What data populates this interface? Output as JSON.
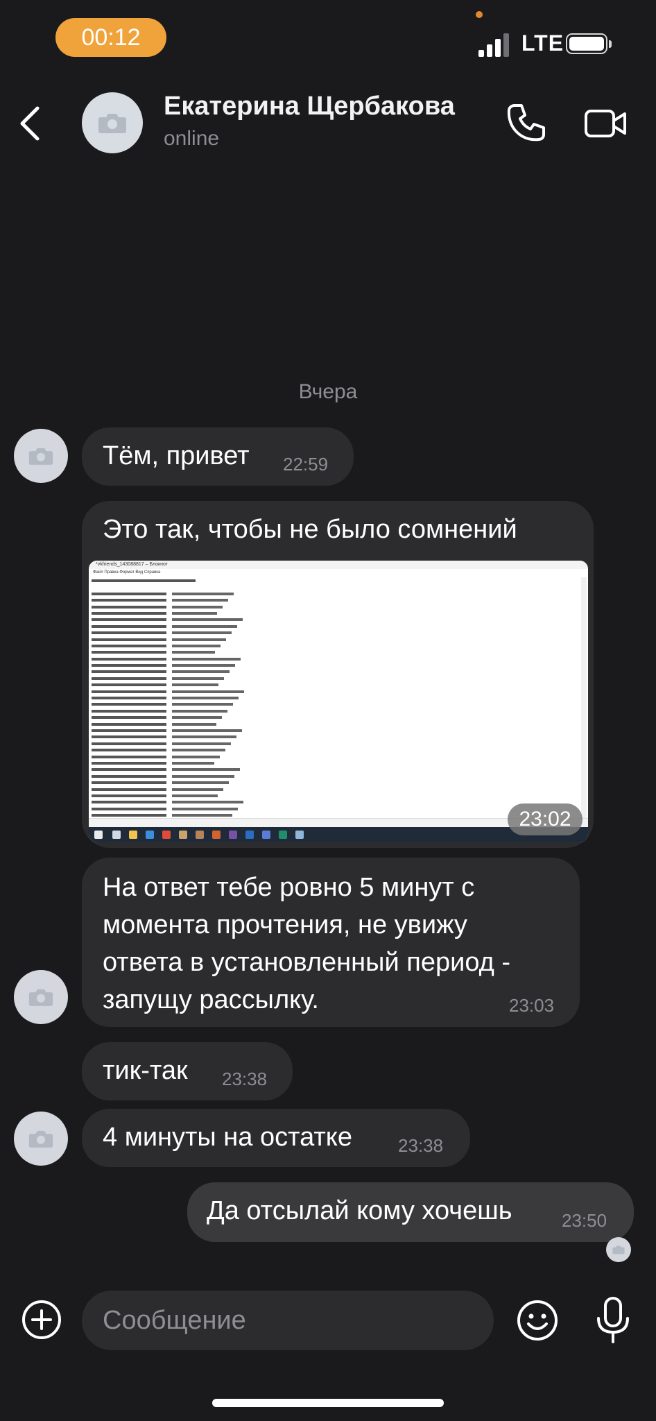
{
  "status_bar": {
    "time": "00:12",
    "network": "LTE"
  },
  "header": {
    "name": "Екатерина Щербакова",
    "status": "online"
  },
  "date_separator": "Вчера",
  "messages": [
    {
      "text": "Тём, привет",
      "time": "22:59",
      "direction": "in"
    },
    {
      "text": "Это так, чтобы не было сомнений",
      "time": "23:02",
      "direction": "in",
      "has_image": true
    },
    {
      "text": "На ответ тебе ровно 5 минут с момента прочтения, не увижу ответа в установленный период - запущу рассылку.",
      "time": "23:03",
      "direction": "in"
    },
    {
      "text": "тик-так",
      "time": "23:38",
      "direction": "in"
    },
    {
      "text": "4 минуты на остатке",
      "time": "23:38",
      "direction": "in"
    },
    {
      "text": "Да отсылай кому хочешь",
      "time": "23:50",
      "direction": "out"
    }
  ],
  "composer": {
    "placeholder": "Сообщение"
  },
  "colors": {
    "background": "#1a1a1c",
    "bubble_in": "#2c2c2e",
    "bubble_out": "#3a3a3c",
    "time_pill": "#f1a33b"
  }
}
